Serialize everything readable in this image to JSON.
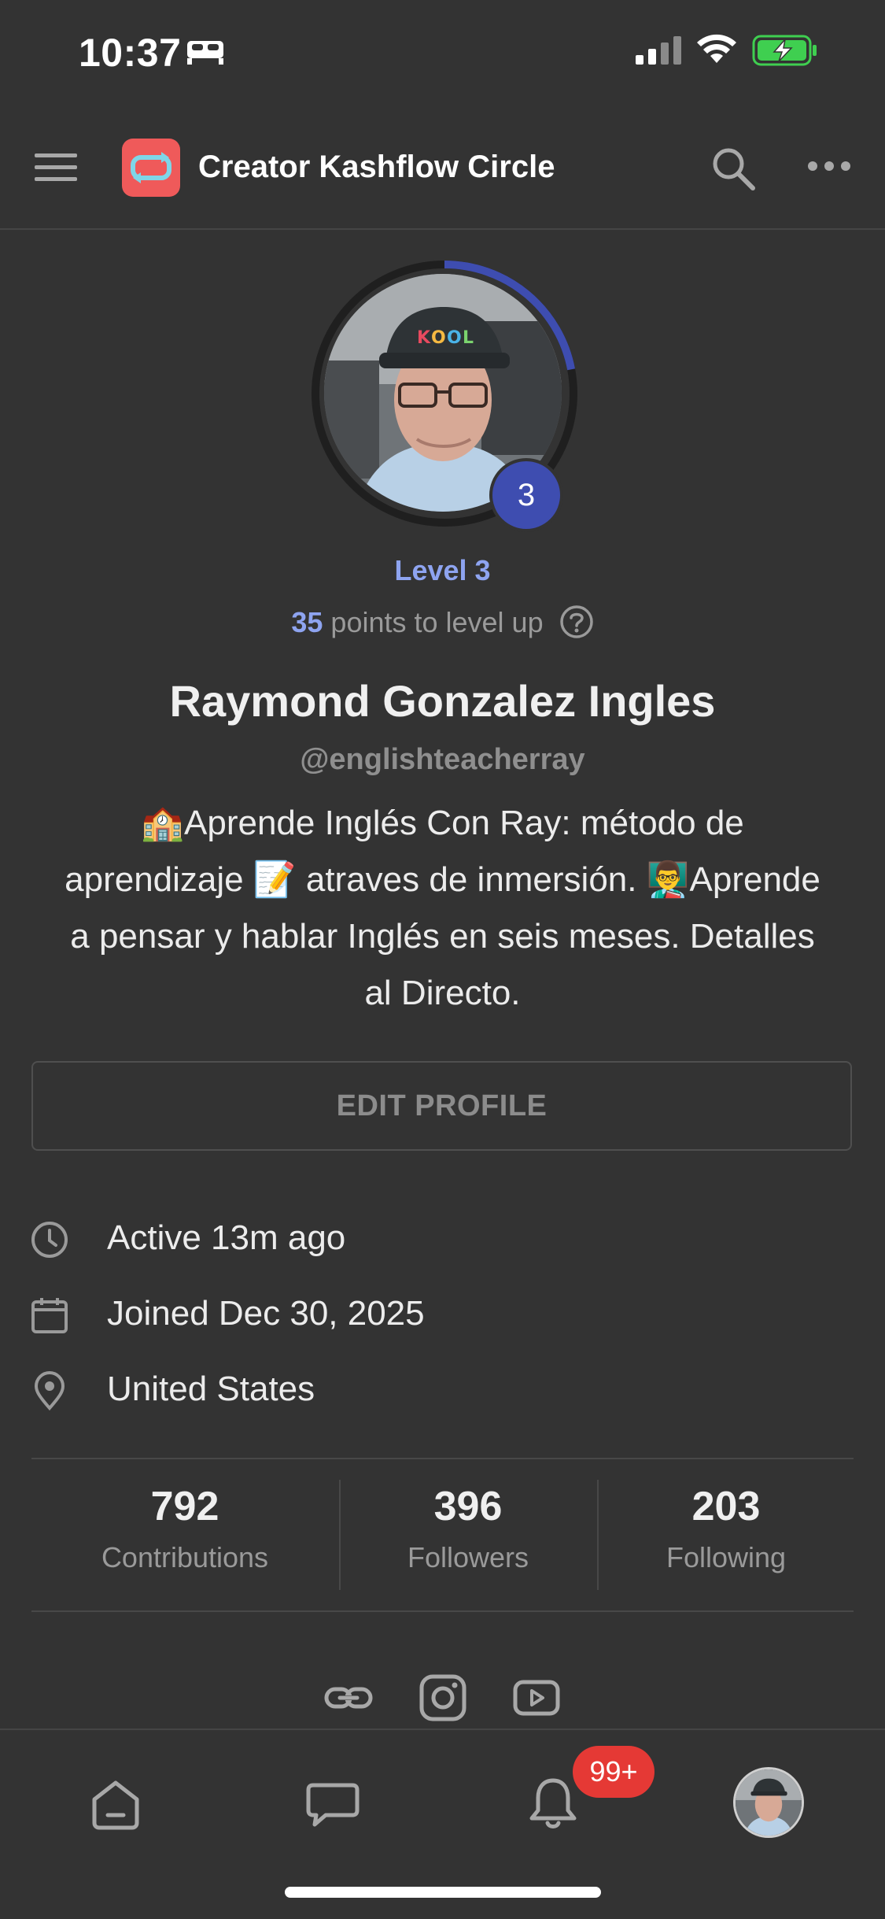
{
  "status_bar": {
    "time": "10:37"
  },
  "header": {
    "title": "Creator Kashflow Circle"
  },
  "profile": {
    "level_badge": "3",
    "level_label": "Level 3",
    "level_progress": 0.22,
    "points_number": "35",
    "points_suffix": " points to level up",
    "name": "Raymond Gonzalez Ingles",
    "handle": "@englishteacherray",
    "bio_lines": [
      "🏫Aprende Inglés Con Ray: método de",
      "aprendizaje 📝 atraves de inmersión. 👨‍🏫Aprende",
      "a pensar y hablar Inglés en seis meses. Detalles",
      "al Directo."
    ],
    "edit_label": "EDIT PROFILE"
  },
  "info": {
    "active": "Active 13m ago",
    "joined": "Joined Dec 30, 2025",
    "location": "United States"
  },
  "stats": [
    {
      "value": "792",
      "label": "Contributions"
    },
    {
      "value": "396",
      "label": "Followers"
    },
    {
      "value": "203",
      "label": "Following"
    }
  ],
  "social_icons": [
    "link-icon",
    "instagram-icon",
    "youtube-icon"
  ],
  "bottom_nav": {
    "notifications_badge": "99+"
  },
  "colors": {
    "background": "#333333",
    "accent_blue": "#8ea4f0",
    "level_ring": "#3e4db0",
    "brand_red": "#ef5a5a",
    "badge_red": "#e53935"
  }
}
